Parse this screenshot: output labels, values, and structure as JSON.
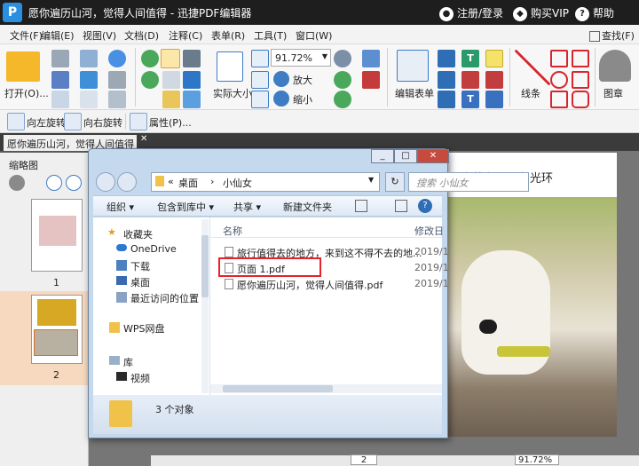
{
  "app": {
    "title": "愿你遍历山河，觉得人间值得 - 迅捷PDF编辑器",
    "logo_text": "P",
    "register": "注册/登录",
    "vip": "购买VIP",
    "help": "帮助"
  },
  "menu": [
    "文件(F)",
    "编辑(E)",
    "视图(V)",
    "文档(D)",
    "注释(C)",
    "表单(R)",
    "工具(T)",
    "窗口(W)"
  ],
  "find": "查找(F)",
  "ribbon": {
    "open": "打开(O)...",
    "zoom": "91.72%",
    "zoom_in": "放大",
    "zoom_out": "缩小",
    "actual_size": "实际大小",
    "edit_form": "编辑表单",
    "lines": "线条",
    "stamp": "图章"
  },
  "rowbar": {
    "rotate_left": "向左旋转",
    "rotate_right": "向右旋转",
    "properties": "属性(P)..."
  },
  "doc_tab": "愿你遍历山河，觉得人间值得",
  "thumbnails": {
    "title": "缩略图",
    "pages": [
      "1",
      "2"
    ]
  },
  "page_text": "已宛若有了主角光环",
  "bottombar": {
    "page": "2",
    "zoom": "91.72%"
  },
  "dialog": {
    "address": [
      "«",
      "桌面",
      "›",
      "小仙女"
    ],
    "search_placeholder": "搜索 小仙女",
    "toolbar": [
      "组织 ▾",
      "包含到库中 ▾",
      "共享 ▾",
      "新建文件夹"
    ],
    "nav": [
      "收藏夹",
      "OneDrive",
      "下载",
      "桌面",
      "最近访问的位置",
      "WPS网盘",
      "库",
      "视频"
    ],
    "columns": [
      "名称",
      "修改日"
    ],
    "files": [
      {
        "name": "旅行值得去的地方，来到这不得不去的地...",
        "date": "2019/1"
      },
      {
        "name": "页面 1.pdf",
        "date": "2019/1"
      },
      {
        "name": "愿你遍历山河，觉得人间值得.pdf",
        "date": "2019/1"
      }
    ],
    "status": "3 个对象",
    "highlight_color": "#e8212a"
  }
}
